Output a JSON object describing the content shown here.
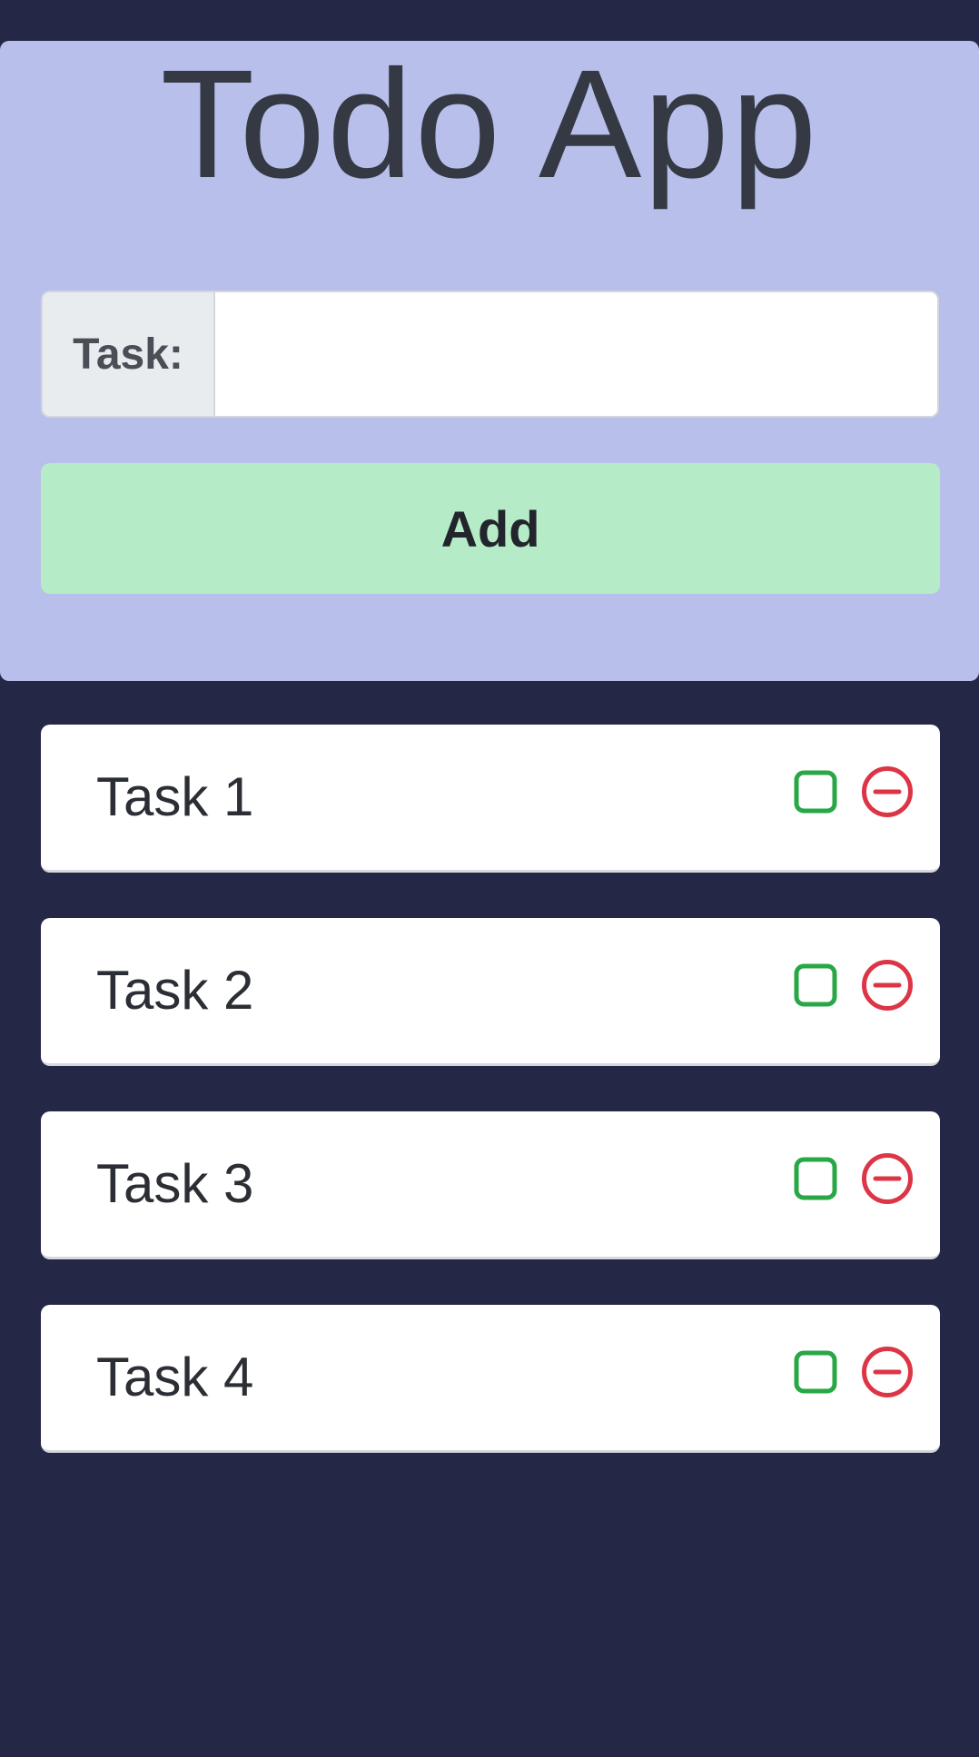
{
  "app": {
    "title": "Todo App"
  },
  "form": {
    "task_label": "Task:",
    "task_value": "",
    "task_placeholder": "",
    "add_label": "Add"
  },
  "todos": [
    {
      "label": "Task 1",
      "completed": false
    },
    {
      "label": "Task 2",
      "completed": false
    },
    {
      "label": "Task 3",
      "completed": false
    },
    {
      "label": "Task 4",
      "completed": false
    }
  ],
  "icons": {
    "checkbox": "checkbox-icon",
    "remove": "minus-circle-icon"
  },
  "colors": {
    "background": "#242746",
    "header_background": "#b8bfeb",
    "add_button": "#b5ebc6",
    "check_green": "#28a745",
    "remove_red": "#dc3545"
  }
}
